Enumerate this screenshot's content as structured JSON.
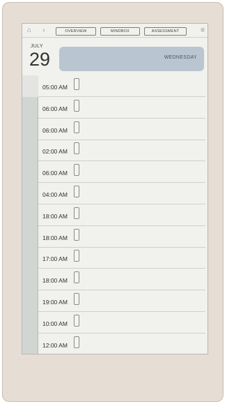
{
  "toolbar": {
    "home_icon": "home-icon",
    "back_icon": "back-arrow-icon",
    "menu_icon": "menu-icon",
    "tabs": [
      "OVERVIEW",
      "MINDBOX",
      "ASSESSMENT"
    ]
  },
  "date": {
    "month": "JULY",
    "day": "29",
    "weekday": "WEDNESDAY"
  },
  "schedule": {
    "times": [
      "05:00 AM",
      "06:00 AM",
      "06:00 AM",
      "02:00 AM",
      "06:00 AM",
      "04:00 AM",
      "18:00 AM",
      "18:00 AM",
      "17:00 AM",
      "18:00 AM",
      "19:00 AM",
      "10:00 AM",
      "12:00 AM"
    ]
  },
  "colors": {
    "device_bezel": "#e6ddd4",
    "screen": "#f1f1ee",
    "day_banner": "#b9c6d1",
    "gutter": "#d2d6d2"
  }
}
